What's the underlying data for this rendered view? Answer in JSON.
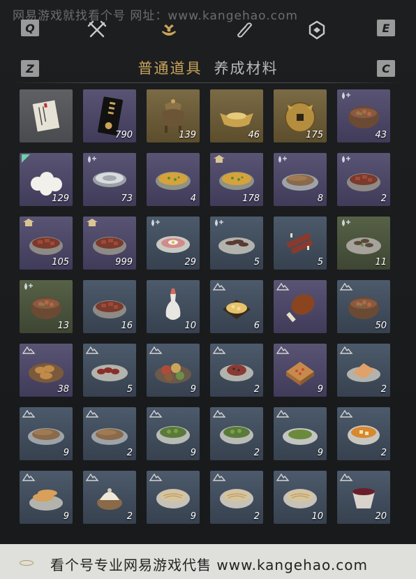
{
  "watermark_top": "网易游戏就找看个号  网址：www.kangehao.com",
  "keys": {
    "q": "Q",
    "e": "E",
    "z": "Z",
    "c": "C"
  },
  "top_icons": [
    "crossed-swords-icon",
    "pouch-icon",
    "scroll-icon",
    "gem-icon"
  ],
  "tabs": [
    {
      "label": "普通道具",
      "active": true
    },
    {
      "label": "养成材料",
      "active": false
    }
  ],
  "items": [
    {
      "kind": "letter",
      "bg": "grey",
      "count": ""
    },
    {
      "kind": "card",
      "bg": "purple",
      "count": "790"
    },
    {
      "kind": "cauldron",
      "bg": "gold",
      "count": "139"
    },
    {
      "kind": "ingot",
      "bg": "gold",
      "count": "46"
    },
    {
      "kind": "coin",
      "bg": "gold",
      "count": "175"
    },
    {
      "kind": "pot",
      "bg": "purple",
      "badge": "drop",
      "count": "43"
    },
    {
      "kind": "buns",
      "bg": "purple",
      "badge": "corner",
      "count": "129"
    },
    {
      "kind": "bowl-white",
      "bg": "purple",
      "badge": "drop",
      "count": "73"
    },
    {
      "kind": "soup-yellow",
      "bg": "purple",
      "count": "4"
    },
    {
      "kind": "soup-yellow",
      "bg": "purple",
      "badge": "house",
      "count": "178"
    },
    {
      "kind": "fish-plate",
      "bg": "purple",
      "badge": "drop",
      "count": "8"
    },
    {
      "kind": "meat-bowl",
      "bg": "purple",
      "badge": "drop",
      "count": "2"
    },
    {
      "kind": "meat-bowl",
      "bg": "purple",
      "badge": "house",
      "count": "105"
    },
    {
      "kind": "meat-bowl",
      "bg": "purple",
      "badge": "house",
      "count": "999"
    },
    {
      "kind": "egg-plate",
      "bg": "blue",
      "badge": "drop",
      "count": "29"
    },
    {
      "kind": "sliced-plate",
      "bg": "blue",
      "badge": "drop",
      "count": "5"
    },
    {
      "kind": "ribs",
      "bg": "blue",
      "count": "5"
    },
    {
      "kind": "mushroom-plate",
      "bg": "green",
      "badge": "drop",
      "count": "11"
    },
    {
      "kind": "pot",
      "bg": "green",
      "badge": "drop",
      "count": "13"
    },
    {
      "kind": "meat-bowl",
      "bg": "blue",
      "count": "16"
    },
    {
      "kind": "vase",
      "bg": "blue",
      "count": "10"
    },
    {
      "kind": "egg-plate-gold",
      "bg": "blue",
      "badge": "mountain",
      "count": "6"
    },
    {
      "kind": "drumstick",
      "bg": "purple",
      "badge": "mountain",
      "count": ""
    },
    {
      "kind": "pot",
      "bg": "blue",
      "badge": "mountain",
      "count": "50"
    },
    {
      "kind": "bread-basket",
      "bg": "purple",
      "badge": "mountain",
      "count": "38"
    },
    {
      "kind": "sausage-plate",
      "bg": "blue",
      "badge": "mountain",
      "count": "5"
    },
    {
      "kind": "feast",
      "bg": "blue",
      "badge": "mountain",
      "count": "9"
    },
    {
      "kind": "meat-plate",
      "bg": "blue",
      "badge": "mountain",
      "count": "2"
    },
    {
      "kind": "cake",
      "bg": "purple",
      "badge": "mountain",
      "count": "9"
    },
    {
      "kind": "pancake",
      "bg": "blue",
      "badge": "mountain",
      "count": "2"
    },
    {
      "kind": "fish-plate",
      "bg": "blue",
      "badge": "mountain",
      "count": "9"
    },
    {
      "kind": "fish-plate",
      "bg": "blue",
      "badge": "mountain",
      "count": "2"
    },
    {
      "kind": "greens-bowl",
      "bg": "blue",
      "badge": "mountain",
      "count": "9"
    },
    {
      "kind": "greens-bowl",
      "bg": "blue",
      "badge": "mountain",
      "count": "2"
    },
    {
      "kind": "greens-plate",
      "bg": "blue",
      "badge": "mountain",
      "count": "9"
    },
    {
      "kind": "soup-orange",
      "bg": "blue",
      "badge": "mountain",
      "count": "2"
    },
    {
      "kind": "flatbread",
      "bg": "blue",
      "badge": "mountain",
      "count": "9"
    },
    {
      "kind": "dumpling",
      "bg": "blue",
      "badge": "mountain",
      "count": "2"
    },
    {
      "kind": "noodle-bowl",
      "bg": "blue",
      "badge": "mountain",
      "count": "9"
    },
    {
      "kind": "noodle-bowl",
      "bg": "blue",
      "badge": "mountain",
      "count": "2"
    },
    {
      "kind": "noodle-bowl",
      "bg": "blue",
      "badge": "mountain",
      "count": "10"
    },
    {
      "kind": "wine-bowl",
      "bg": "blue",
      "badge": "mountain",
      "count": "20"
    }
  ],
  "bottom_watermark": "看个号专业网易游戏代售  www.kangehao.com"
}
